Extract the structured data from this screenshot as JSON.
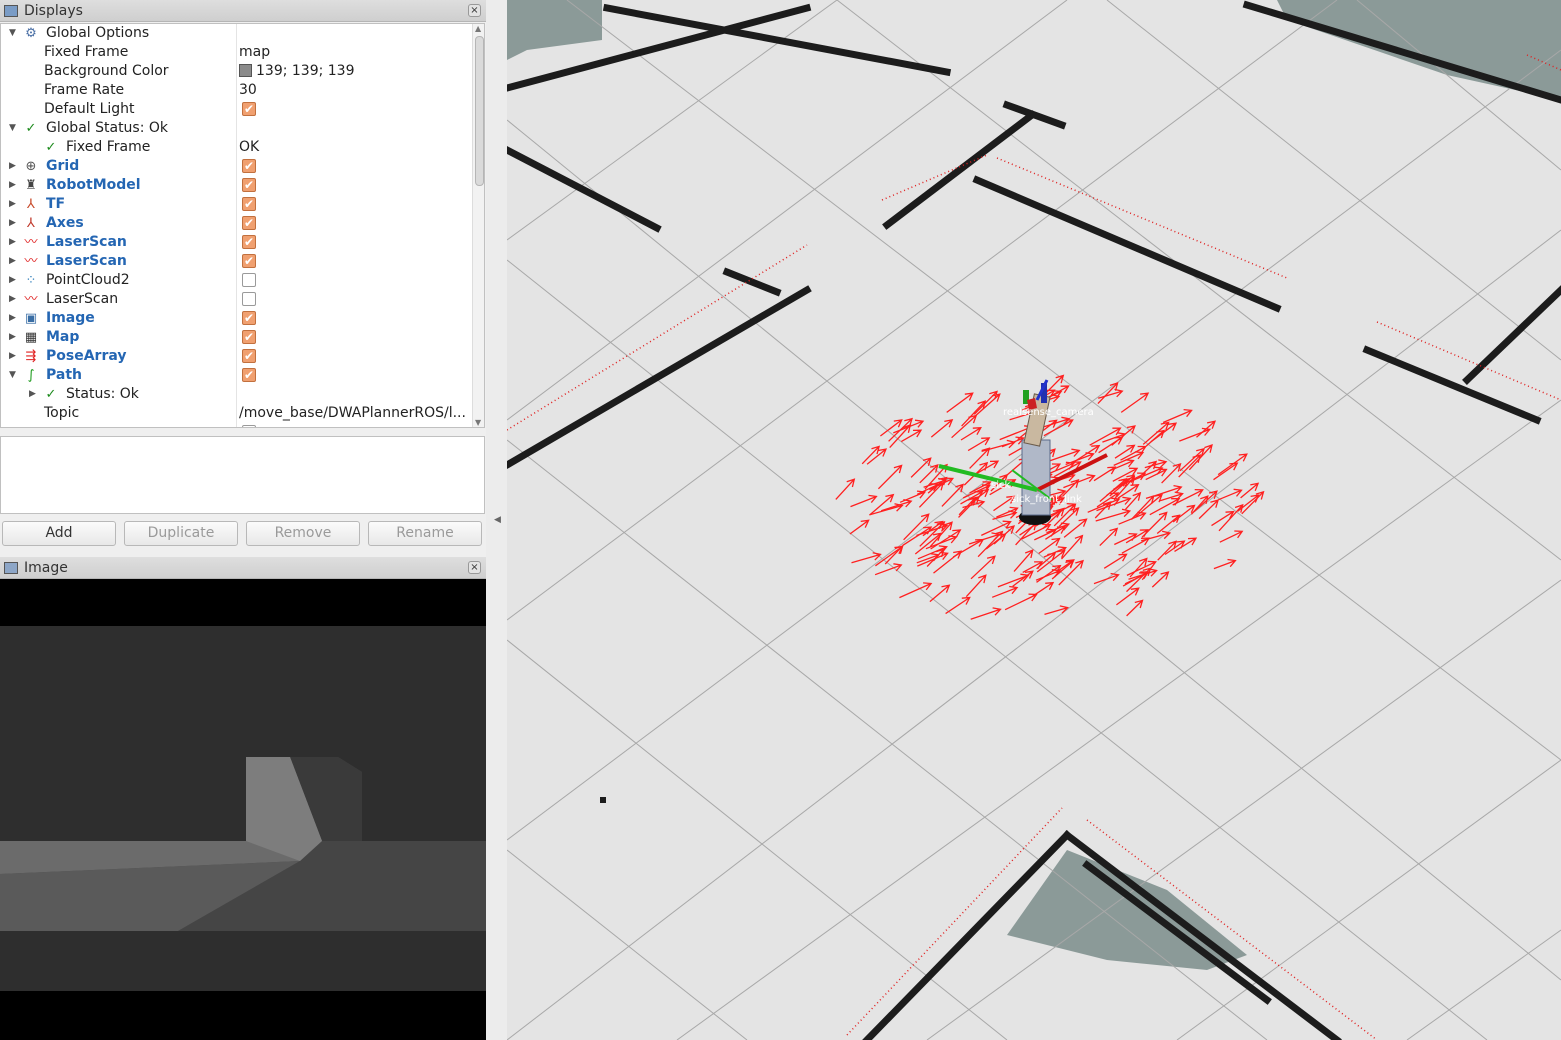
{
  "displays_panel": {
    "title": "Displays",
    "close_glyph": "×",
    "rows": {
      "global_options": "Global Options",
      "fixed_frame": {
        "label": "Fixed Frame",
        "value": "map"
      },
      "background_color": {
        "label": "Background Color",
        "value": "139; 139; 139",
        "swatch": "#8b8b8b"
      },
      "frame_rate": {
        "label": "Frame Rate",
        "value": "30"
      },
      "default_light": {
        "label": "Default Light",
        "checked": true
      },
      "global_status": "Global Status: Ok",
      "status_fixed_frame": {
        "label": "Fixed Frame",
        "value": "OK"
      },
      "grid": {
        "label": "Grid",
        "checked": true
      },
      "robot_model": {
        "label": "RobotModel",
        "checked": true
      },
      "tf": {
        "label": "TF",
        "checked": true
      },
      "axes": {
        "label": "Axes",
        "checked": true
      },
      "laserscan_1": {
        "label": "LaserScan",
        "checked": true
      },
      "laserscan_2": {
        "label": "LaserScan",
        "checked": true
      },
      "pointcloud2": {
        "label": "PointCloud2",
        "checked": false
      },
      "laserscan_3": {
        "label": "LaserScan",
        "checked": false
      },
      "image": {
        "label": "Image",
        "checked": true
      },
      "map": {
        "label": "Map",
        "checked": true
      },
      "pose_array": {
        "label": "PoseArray",
        "checked": true
      },
      "path": {
        "label": "Path",
        "checked": true
      },
      "path_status": "Status: Ok",
      "topic": {
        "label": "Topic",
        "value": "/move_base/DWAPlannerROS/l..."
      }
    }
  },
  "buttons": {
    "add": "Add",
    "duplicate": "Duplicate",
    "remove": "Remove",
    "rename": "Rename"
  },
  "image_panel": {
    "title": "Image",
    "close_glyph": "×"
  },
  "scene": {
    "frame_labels": [
      "realsense_camera",
      "sick",
      "sick_front_link"
    ],
    "map_background": "#8b9a98",
    "grid_color": "#9e9e9e",
    "pose_color": "#ff2020"
  },
  "icons": {
    "displays": "monitor-icon",
    "global_options": "gear-icon",
    "status_ok": "check-icon",
    "grid": "grid-icon",
    "robot_model": "robot-icon",
    "tf": "tf-icon",
    "axes": "axes-icon",
    "laserscan": "laserscan-icon",
    "pointcloud2": "pointcloud-icon",
    "image": "image-icon",
    "map": "map-icon",
    "pose_array": "pose-array-icon",
    "path": "path-icon"
  }
}
